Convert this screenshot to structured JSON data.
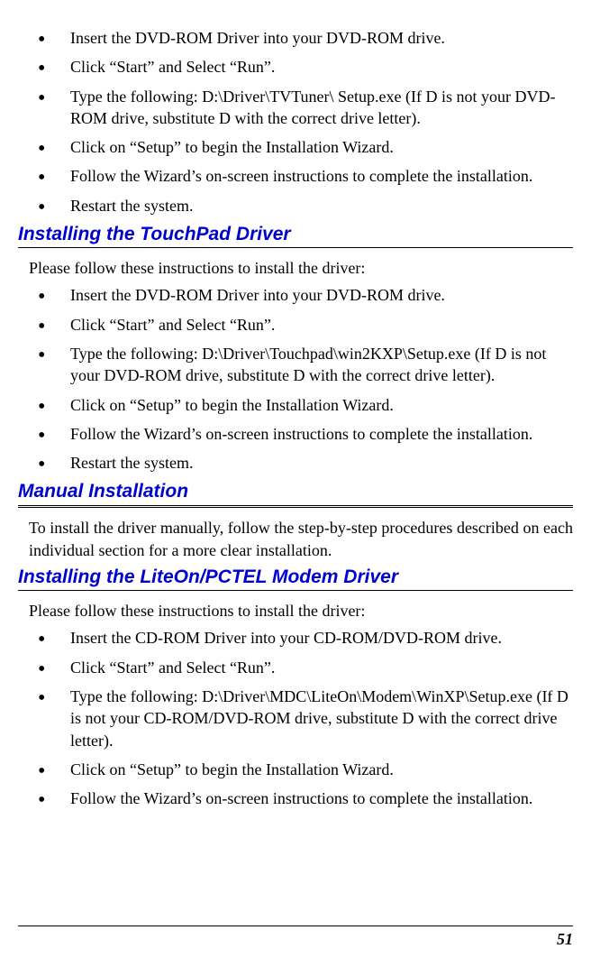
{
  "section1": {
    "items": [
      "Insert the DVD-ROM Driver into your DVD-ROM drive.",
      "Click “Start” and Select “Run”.",
      "Type the following: D:\\Driver\\TVTuner\\ Setup.exe (If D is not your DVD-ROM drive, substitute D with the correct drive letter).",
      "Click on “Setup” to begin the Installation Wizard.",
      "Follow the Wizard’s on-screen instructions to complete the installation.",
      "Restart the system."
    ]
  },
  "section2": {
    "heading": "Installing the TouchPad Driver",
    "intro": "Please follow these instructions to install the driver:",
    "items": [
      "Insert the DVD-ROM Driver into your DVD-ROM drive.",
      "Click “Start” and Select “Run”.",
      "Type the following: D:\\Driver\\Touchpad\\win2KXP\\Setup.exe (If D is not your DVD-ROM drive, substitute D with the correct drive letter).",
      "Click on “Setup” to begin the Installation Wizard.",
      "Follow the Wizard’s on-screen instructions to complete the installation.",
      "Restart the system."
    ]
  },
  "section3": {
    "heading": "Manual Installation",
    "intro": "To install the driver manually, follow the step-by-step procedures described on each individual section for a more clear installation."
  },
  "section4": {
    "heading": "Installing the LiteOn/PCTEL Modem Driver",
    "intro": "Please follow these instructions to install the driver:",
    "items": [
      "Insert the CD-ROM Driver into your CD-ROM/DVD-ROM drive.",
      "Click “Start” and Select “Run”.",
      "Type the following: D:\\Driver\\MDC\\LiteOn\\Modem\\WinXP\\Setup.exe (If D is not your CD-ROM/DVD-ROM drive, substitute D with the correct drive letter).",
      "Click on “Setup” to begin the Installation Wizard.",
      "Follow the Wizard’s on-screen instructions to complete the installation."
    ]
  },
  "page_number": "51"
}
